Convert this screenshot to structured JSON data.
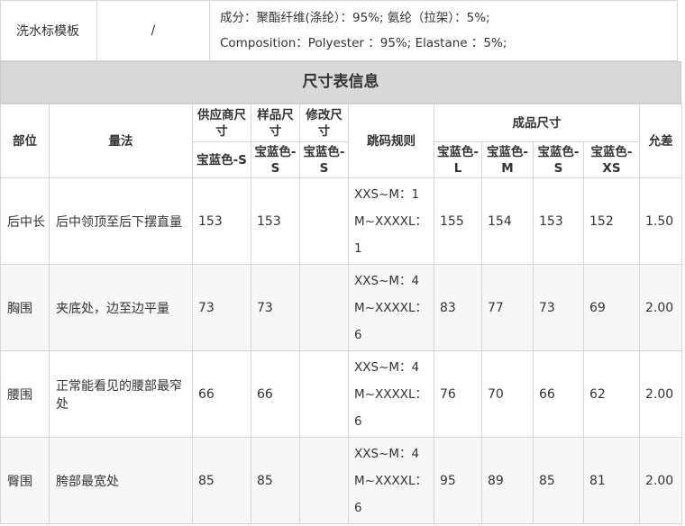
{
  "wash_label": {
    "label": "洗水标模板",
    "value": "/",
    "composition_cn": "成分：聚酯纤维(涤纶）：95%; 氨纶（拉架）：5%;",
    "composition_en": "Composition：Polyester ：95%; Elastane ：5%;"
  },
  "size_chart": {
    "title": "尺寸表信息",
    "headers": {
      "part": "部位",
      "method": "量法",
      "supplier_size": "供应商尺寸",
      "sample_size": "样品尺寸",
      "modified_size": "修改尺寸",
      "grading_rule": "跳码规则",
      "finished_size": "成品尺寸",
      "tolerance": "允差"
    },
    "sub_headers": {
      "supplier": "宝蓝色-S",
      "sample": "宝蓝色-S",
      "modified": "宝蓝色-S",
      "finished": [
        "宝蓝色-L",
        "宝蓝色-M",
        "宝蓝色-S",
        "宝蓝色-XS"
      ]
    },
    "rows": [
      {
        "part": "后中长",
        "method": "后中领顶至后下摆直量",
        "supplier": "153",
        "sample": "153",
        "modified": "",
        "rule_1": "XXS~M：1",
        "rule_2": "M~XXXXL：1",
        "finished": [
          "155",
          "154",
          "153",
          "152"
        ],
        "tolerance": "1.50"
      },
      {
        "part": "胸围",
        "method": "夹底处，边至边平量",
        "supplier": "73",
        "sample": "73",
        "modified": "",
        "rule_1": "XXS~M：4",
        "rule_2": "M~XXXXL：6",
        "finished": [
          "83",
          "77",
          "73",
          "69"
        ],
        "tolerance": "2.00"
      },
      {
        "part": "腰围",
        "method": "正常能看见的腰部最窄处",
        "supplier": "66",
        "sample": "66",
        "modified": "",
        "rule_1": "XXS~M：4",
        "rule_2": "M~XXXXL：6",
        "finished": [
          "76",
          "70",
          "66",
          "62"
        ],
        "tolerance": "2.00"
      },
      {
        "part": "臀围",
        "method": "胯部最宽处",
        "supplier": "85",
        "sample": "85",
        "modified": "",
        "rule_1": "XXS~M：4",
        "rule_2": "M~XXXXL：6",
        "finished": [
          "95",
          "89",
          "85",
          "81"
        ],
        "tolerance": "2.00"
      }
    ]
  }
}
